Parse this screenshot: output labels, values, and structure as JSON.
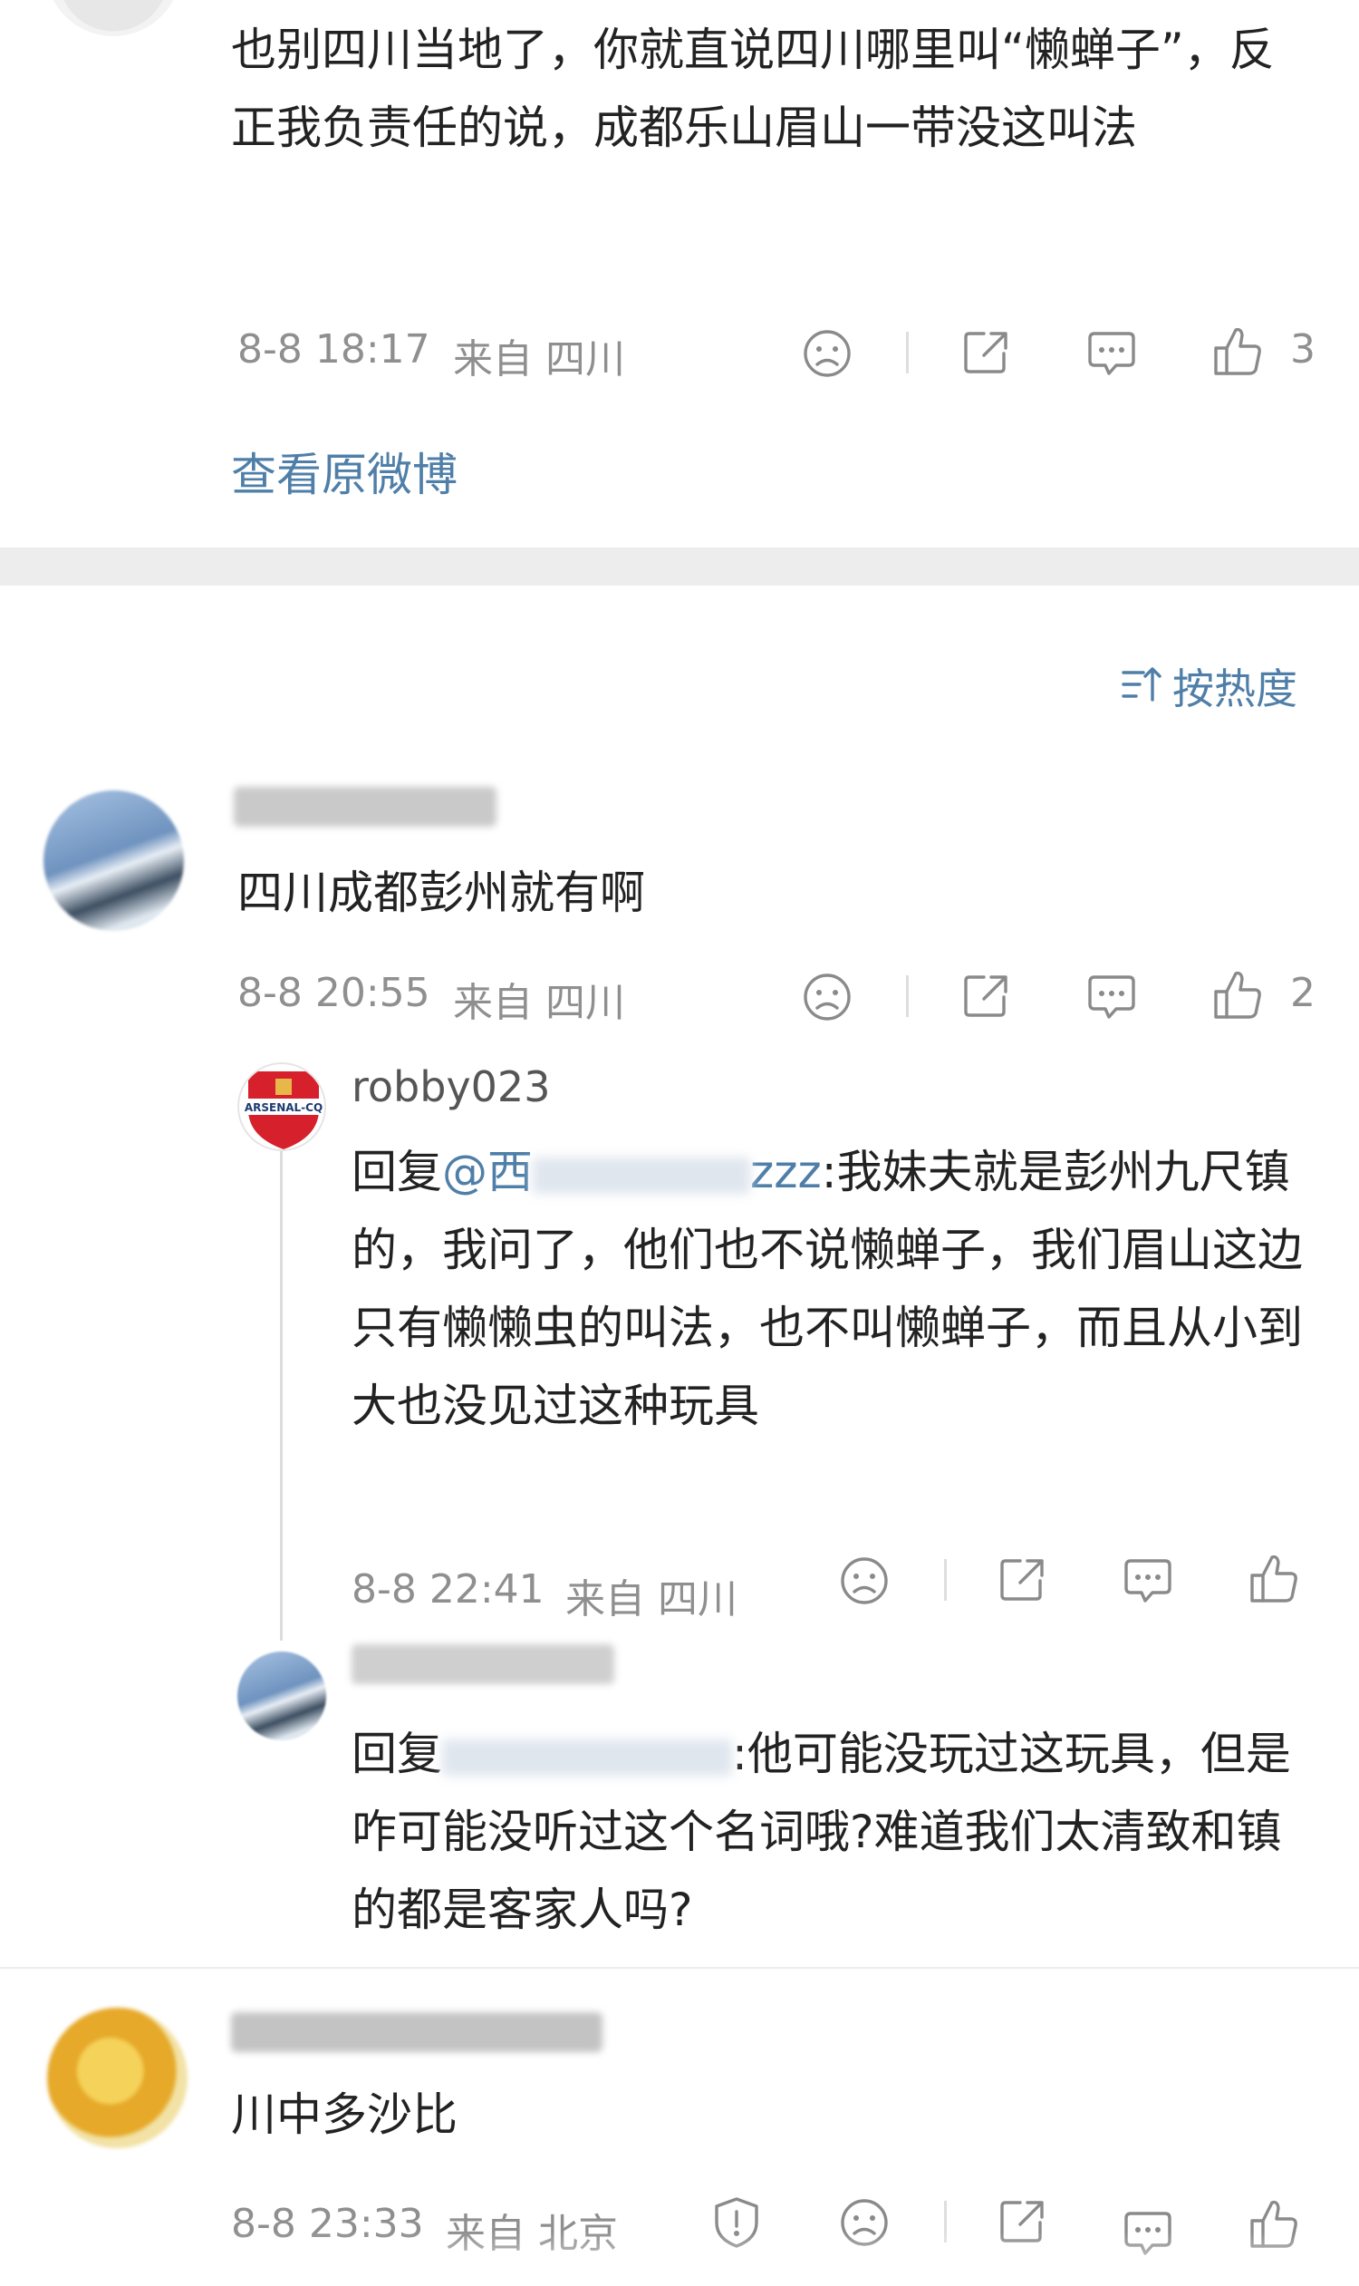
{
  "post": {
    "text": "也别四川当地了，你就直说四川哪里叫“懒蝉子”，反正我负责任的说，成都乐山眉山一带没这叫法",
    "time": "8-8 18:17",
    "location": "来自 四川",
    "likes": "3",
    "view_original": "查看原微博"
  },
  "sort_label": "按热度",
  "comments": [
    {
      "text": "四川成都彭州就有啊",
      "time": "8-8 20:55",
      "location": "来自 四川",
      "likes": "2",
      "replies": [
        {
          "user": "robby023",
          "avatar_text": "ARSENAL-CQ",
          "reply_prefix": "回复",
          "mention": "@西",
          "mention_tail": "zzz",
          "text": ":我妹夫就是彭州九尺镇的，我问了，他们也不说懒蝉子，我们眉山这边只有懒懒虫的叫法，也不叫懒蝉子，而且从小到大也没见过这种玩具",
          "time": "8-8 22:41",
          "location": "来自 四川"
        },
        {
          "reply_prefix": "回复",
          "text": ":他可能没玩过这玩具，但是咋可能没听过这个名词哦?难道我们太清致和镇的都是客家人吗?"
        }
      ]
    },
    {
      "text": "川中多沙比",
      "time": "8-8 23:33",
      "location": "来自 北京"
    }
  ],
  "icons": [
    "sad-face-icon",
    "share-icon",
    "comment-icon",
    "thumbs-up-icon",
    "sort-icon",
    "report-shield-icon"
  ],
  "colors": {
    "link": "#4f7fa8",
    "meta": "#8f8f8f",
    "separator": "#ededed"
  }
}
